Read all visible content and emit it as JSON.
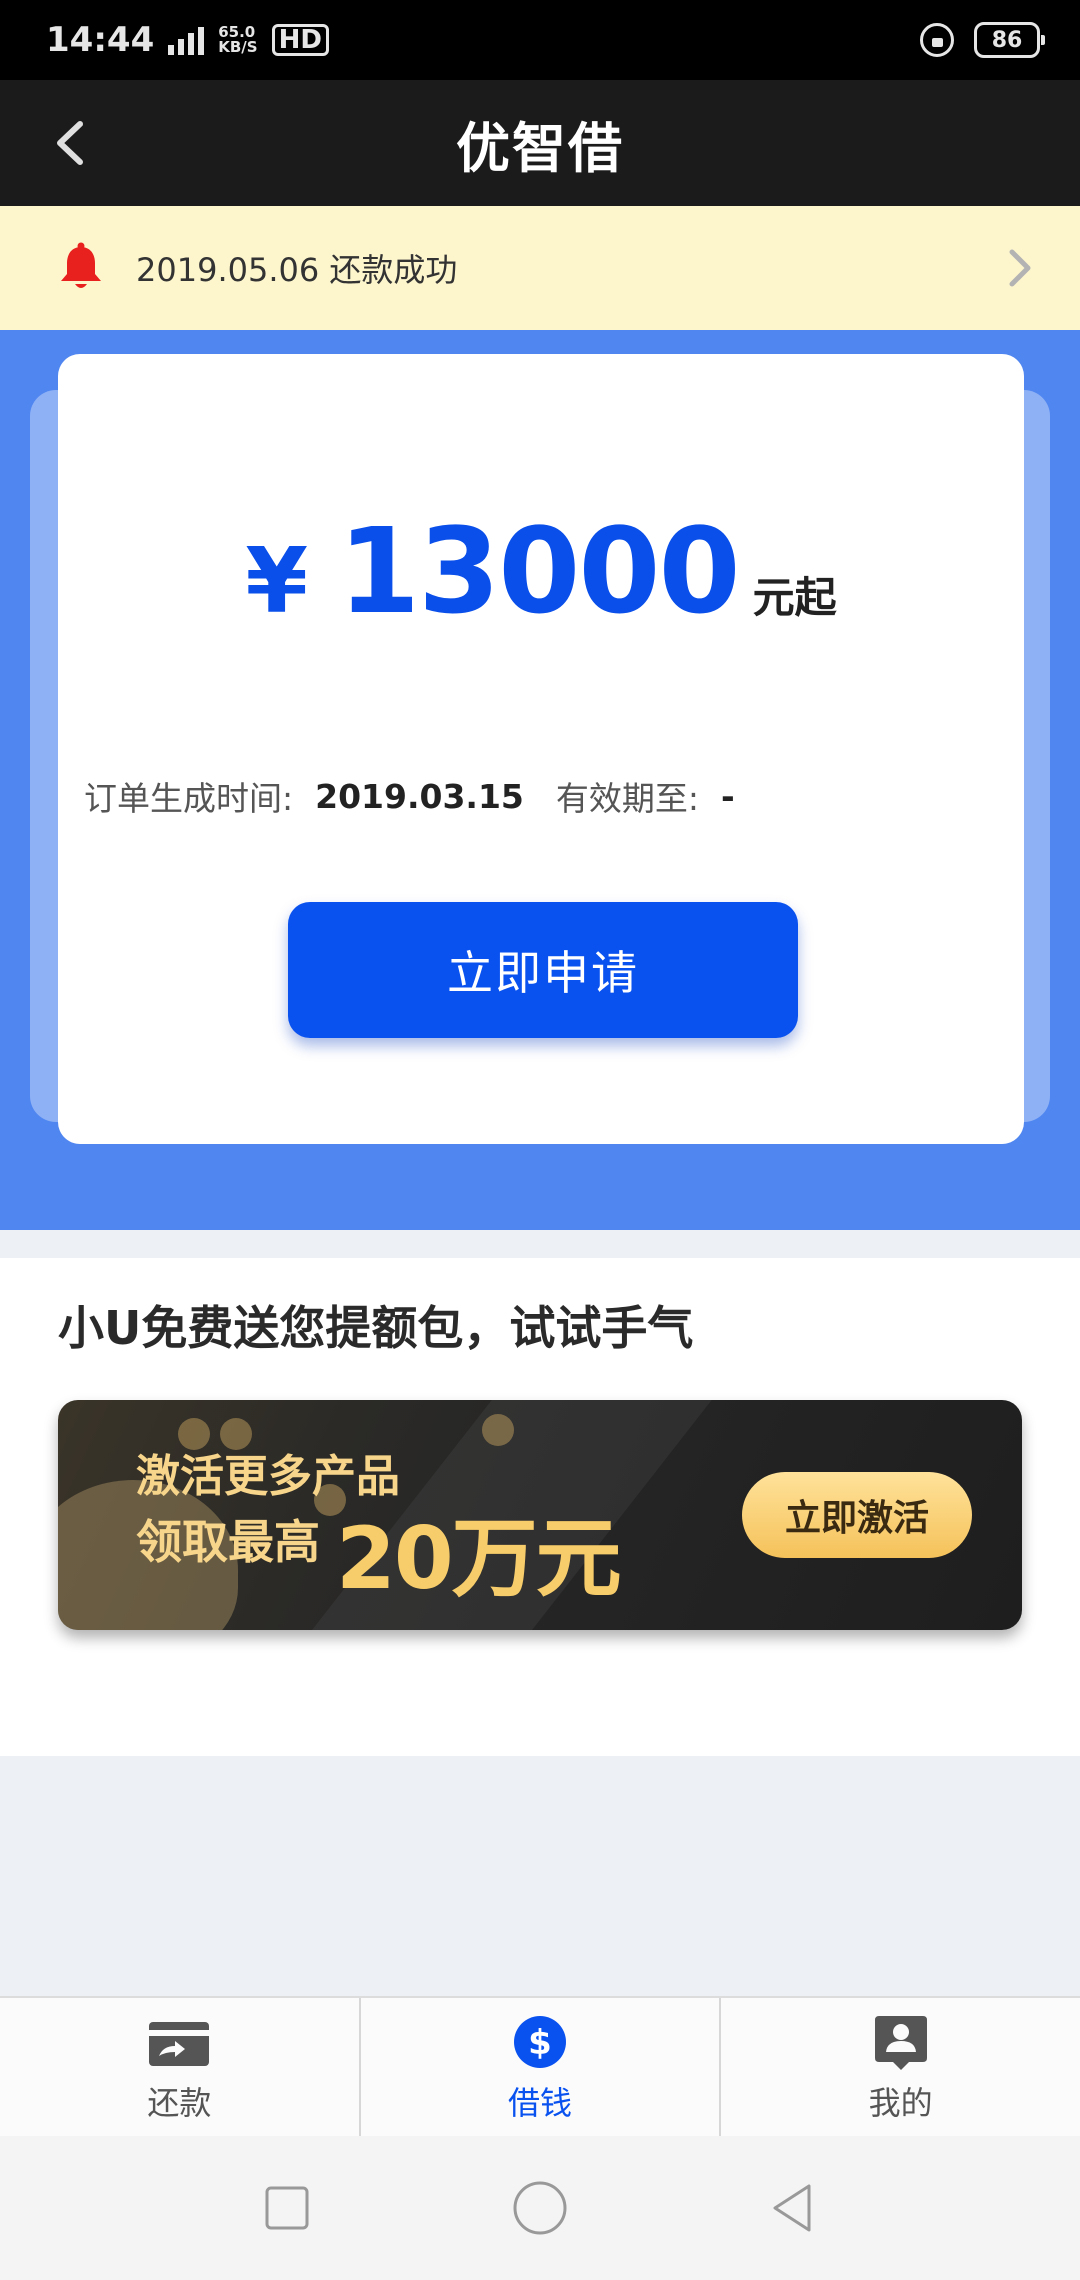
{
  "status_bar": {
    "time": "14:44",
    "network": "4G",
    "speed_value": "65.0",
    "speed_unit": "KB/S",
    "hd": "HD",
    "battery": "86"
  },
  "nav": {
    "title": "优智借",
    "back_icon": "chevron-left-icon"
  },
  "notice": {
    "text": "2019.05.06 还款成功",
    "icon": "bell-icon",
    "icon_color": "#e8201e"
  },
  "loan_card": {
    "currency": "¥",
    "amount": "13000",
    "unit": "元起",
    "order_time_label": "订单生成时间:",
    "order_time_value": "2019.03.15",
    "valid_until_label": "有效期至:",
    "valid_until_value": "-",
    "apply_button": "立即申请"
  },
  "promo": {
    "heading": "小U免费送您提额包，试试手气",
    "banner_line1": "激活更多产品",
    "banner_line2": "领取最高",
    "banner_highlight": "20万元",
    "banner_button": "立即激活"
  },
  "tabs": [
    {
      "label": "还款",
      "icon": "repay-card-icon",
      "active": false
    },
    {
      "label": "借钱",
      "icon": "dollar-circle-icon",
      "active": true
    },
    {
      "label": "我的",
      "icon": "profile-icon",
      "active": false
    }
  ],
  "colors": {
    "primary": "#0a52f0",
    "hero_bg": "#4f86f0",
    "notice_bg": "#fdf6cd",
    "nav_bg": "#1b1b1b"
  }
}
